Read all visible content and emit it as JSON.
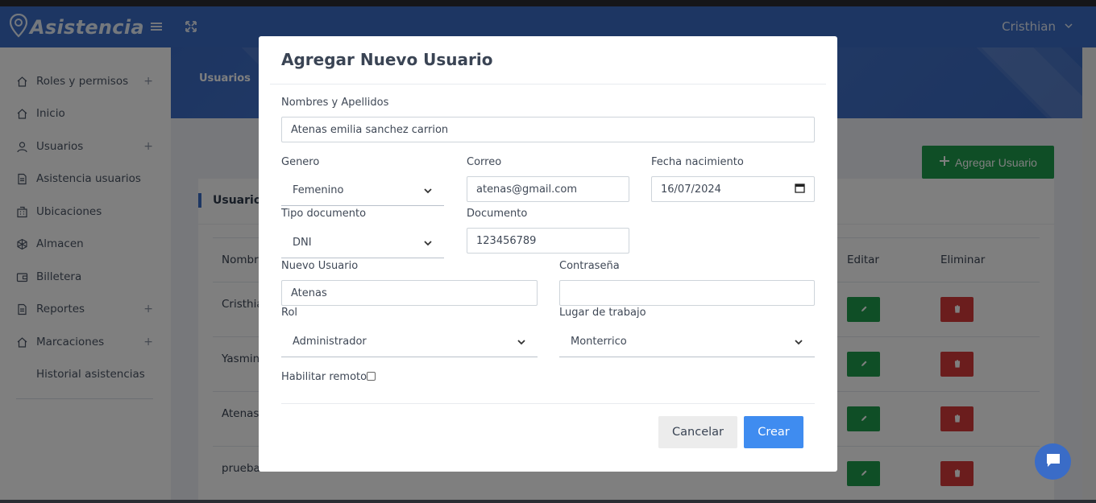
{
  "app": {
    "brand": "Asistencia",
    "user_name": "Cristhian",
    "accent": "#3a6cc7"
  },
  "sidebar": {
    "items": [
      {
        "label": "Roles y permisos",
        "icon": "home-icon",
        "expandable": true
      },
      {
        "label": "Inicio",
        "icon": "home-icon",
        "expandable": false
      },
      {
        "label": "Usuarios",
        "icon": "user-icon",
        "expandable": true
      },
      {
        "label": "Asistencia usuarios",
        "icon": "document-icon",
        "expandable": false
      },
      {
        "label": "Ubicaciones",
        "icon": "building-icon",
        "expandable": false
      },
      {
        "label": "Almacen",
        "icon": "grid-icon",
        "expandable": false
      },
      {
        "label": "Billetera",
        "icon": "wallet-icon",
        "expandable": false
      },
      {
        "label": "Reportes",
        "icon": "document-icon",
        "expandable": true
      },
      {
        "label": "Marcaciones",
        "icon": "home-icon",
        "expandable": true
      },
      {
        "label": "Historial asistencias",
        "icon": "",
        "expandable": false
      }
    ],
    "plus_symbol": "+"
  },
  "page": {
    "hero_title": "Usuarios",
    "add_button": "Agregar Usuario",
    "card_title": "Usuarios",
    "columns": {
      "name": "Nombre",
      "edit": "Editar",
      "delete": "Eliminar"
    },
    "rows": [
      {
        "name": "Cristhia"
      },
      {
        "name": "Yasmin"
      },
      {
        "name": "Atenas"
      },
      {
        "name": "prueba"
      }
    ]
  },
  "modal": {
    "title": "Agregar Nuevo Usuario",
    "fields": {
      "full_name": {
        "label": "Nombres y Apellidos",
        "value": "Atenas emilia sanchez carrion"
      },
      "gender": {
        "label": "Genero",
        "value": "Femenino"
      },
      "email": {
        "label": "Correo",
        "value": "atenas@gmail.com"
      },
      "birth_date": {
        "label": "Fecha nacimiento",
        "value": "16/07/2024"
      },
      "doc_type": {
        "label": "Tipo documento",
        "value": "DNI"
      },
      "document": {
        "label": "Documento",
        "value": "123456789"
      },
      "username": {
        "label": "Nuevo Usuario",
        "value": "Atenas"
      },
      "password": {
        "label": "Contraseña",
        "value": ""
      },
      "role": {
        "label": "Rol",
        "value": "Administrador"
      },
      "workplace": {
        "label": "Lugar de trabajo",
        "value": "Monterrico"
      },
      "remote": {
        "label": "Habilitar remoto",
        "checked": false
      }
    },
    "cancel_label": "Cancelar",
    "create_label": "Crear"
  }
}
